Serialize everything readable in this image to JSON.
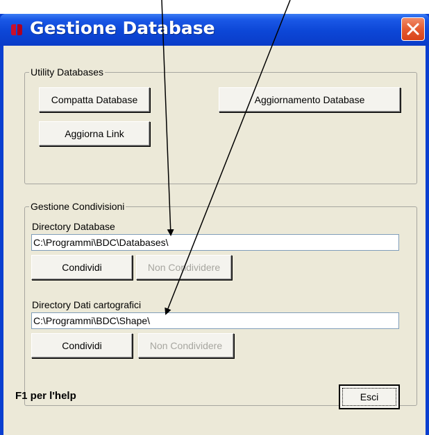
{
  "window": {
    "title": "Gestione Database",
    "close_icon": "close-icon"
  },
  "utility_group": {
    "legend": "Utility Databases",
    "compatta_label": "Compatta Database",
    "aggiornamento_label": "Aggiornamento Database",
    "aggiorna_link_label": "Aggiorna Link"
  },
  "condivisioni_group": {
    "legend": "Gestione Condivisioni",
    "database": {
      "label": "Directory Database",
      "path": "C:\\Programmi\\BDC\\Databases\\",
      "share_label": "Condividi",
      "unshare_label": "Non Condividere"
    },
    "cartografici": {
      "label": "Directory Dati cartografici",
      "path": "C:\\Programmi\\BDC\\Shape\\",
      "share_label": "Condividi",
      "unshare_label": "Non Condividere"
    }
  },
  "footer": {
    "help_text": "F1 per l'help",
    "exit_label": "Esci"
  },
  "colors": {
    "titlebar": "#0c46d6",
    "close_button": "#e45a30",
    "client_background": "#ece9d8",
    "disabled_text": "#a7a6a0"
  }
}
